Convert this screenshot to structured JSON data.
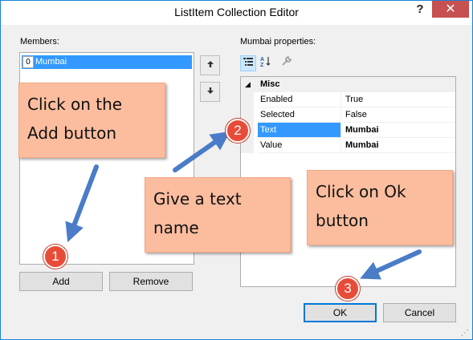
{
  "window": {
    "title": "ListItem Collection Editor",
    "help_label": "?",
    "close_label": "✕"
  },
  "members": {
    "label": "Members:",
    "items": [
      {
        "index": "0",
        "text": "Mumbai"
      }
    ],
    "move_up_glyph": "🡅",
    "move_down_glyph": "🡇",
    "add_label": "Add",
    "remove_label": "Remove"
  },
  "properties": {
    "label": "Mumbai properties:",
    "category": "Misc",
    "rows": [
      {
        "name": "Enabled",
        "value": "True"
      },
      {
        "name": "Selected",
        "value": "False"
      },
      {
        "name": "Text",
        "value": "Mumbai"
      },
      {
        "name": "Value",
        "value": "Mumbai"
      }
    ]
  },
  "buttons": {
    "ok_label": "OK",
    "cancel_label": "Cancel"
  },
  "annotations": {
    "note1_line1": "Click on the",
    "note1_line2": "Add button",
    "note2_line1": "Give a text",
    "note2_line2": "name",
    "note3_line1": "Click on Ok",
    "note3_line2": "button",
    "badge1": "1",
    "badge2": "2",
    "badge3": "3",
    "note_color": "#fbbd9e",
    "arrow_color": "#4a7cc7",
    "badge_color": "#e84c38"
  },
  "colors": {
    "selection": "#3399ff",
    "close_button": "#c75050",
    "window_border": "#1883d7"
  }
}
